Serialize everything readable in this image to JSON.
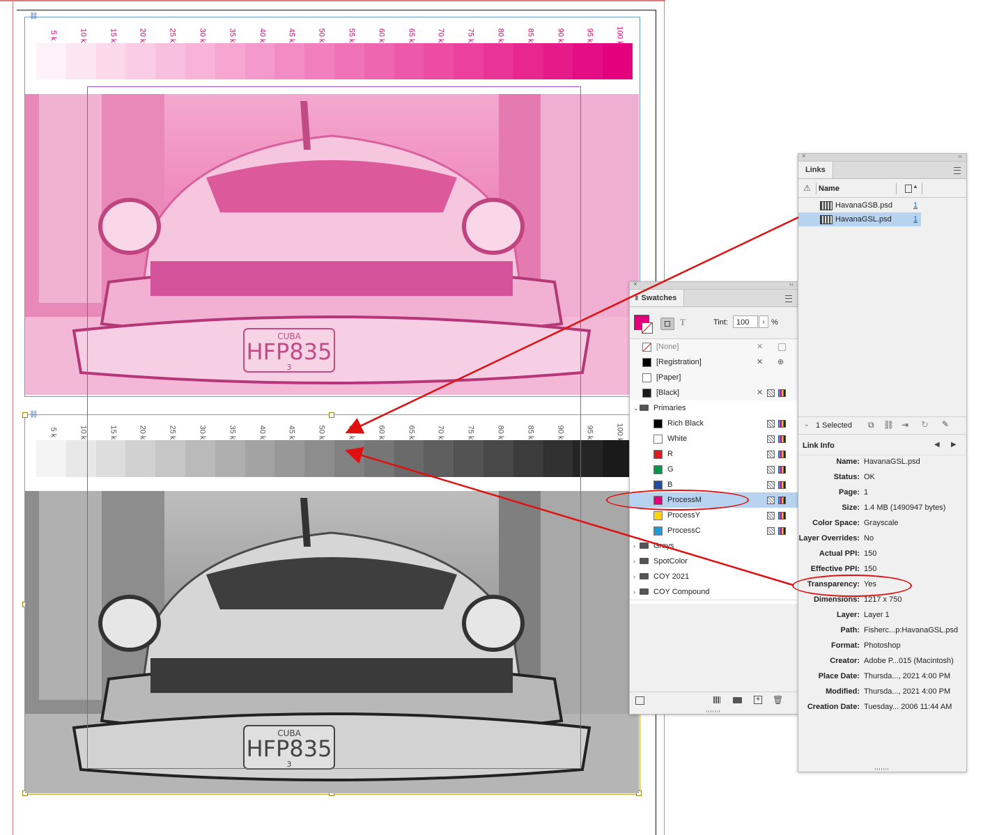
{
  "document": {
    "top_strip_labels": [
      "5 k",
      "10 k",
      "15 k",
      "20 k",
      "25 k",
      "30 k",
      "35 k",
      "40 k",
      "45 k",
      "50 k",
      "55 k",
      "60 k",
      "65 k",
      "70 k",
      "75 k",
      "80 k",
      "85 k",
      "90 k",
      "95 k",
      "100 k"
    ],
    "bottom_strip_labels": [
      "5 k",
      "10 k",
      "15 k",
      "20 k",
      "25 k",
      "30 k",
      "35 k",
      "40 k",
      "45 k",
      "50 k",
      "55 k",
      "60 k",
      "65 k",
      "70 k",
      "75 k",
      "80 k",
      "85 k",
      "90 k",
      "95 k",
      "100 k"
    ],
    "plate_text_cuba": "CUBA",
    "plate_text_number": "HFP835",
    "plate_text_small": "3",
    "colors": {
      "magenta": "#e4007c",
      "black": "#1a1a1a",
      "red_guide": "#e07a7a",
      "frame_blue": "#6a9ec9",
      "frame_gold": "#b89a2a",
      "frame_purple": "#9b4fc9"
    }
  },
  "links_panel": {
    "tab": "Links",
    "col_name": "Name",
    "items": [
      {
        "name": "HavanaGSB.psd",
        "page": "1",
        "selected": false
      },
      {
        "name": "HavanaGSL.psd",
        "page": "1",
        "selected": true
      }
    ],
    "selected_count": "1 Selected",
    "link_info_title": "Link Info",
    "info": [
      {
        "k": "Name:",
        "v": "HavanaGSL.psd"
      },
      {
        "k": "Status:",
        "v": "OK"
      },
      {
        "k": "Page:",
        "v": "1"
      },
      {
        "k": "Size:",
        "v": "1.4 MB (1490947 bytes)"
      },
      {
        "k": "Color Space:",
        "v": "Grayscale"
      },
      {
        "k": "Layer Overrides:",
        "v": "No"
      },
      {
        "k": "Actual PPI:",
        "v": "150"
      },
      {
        "k": "Effective PPI:",
        "v": "150"
      },
      {
        "k": "Transparency:",
        "v": "Yes"
      },
      {
        "k": "Dimensions:",
        "v": "1217 x 750"
      },
      {
        "k": "Layer:",
        "v": "Layer 1"
      },
      {
        "k": "Path:",
        "v": "Fisherc...p:HavanaGSL.psd"
      },
      {
        "k": "Format:",
        "v": "Photoshop"
      },
      {
        "k": "Creator:",
        "v": "Adobe P...015 (Macintosh)"
      },
      {
        "k": "Place Date:",
        "v": "Thursda..., 2021 4:00 PM"
      },
      {
        "k": "Modified:",
        "v": "Thursda..., 2021 4:00 PM"
      },
      {
        "k": "Creation Date:",
        "v": "Tuesday... 2006 11:44 AM"
      }
    ]
  },
  "swatches_panel": {
    "tab": "Swatches",
    "tint_label": "Tint:",
    "tint_value": "100",
    "percent": "%",
    "text_icon": "T",
    "items": [
      {
        "name": "[None]",
        "color": "none",
        "indent": false,
        "folder": false,
        "dim": true
      },
      {
        "name": "[Registration]",
        "color": "#000000",
        "indent": false,
        "folder": false
      },
      {
        "name": "[Paper]",
        "color": "#ffffff",
        "indent": false,
        "folder": false
      },
      {
        "name": "[Black]",
        "color": "#1a1a1a",
        "indent": false,
        "folder": false
      },
      {
        "name": "Primaries",
        "color": "",
        "indent": false,
        "folder": true,
        "open": true
      },
      {
        "name": "Rich Black",
        "color": "#000000",
        "indent": true,
        "folder": false
      },
      {
        "name": "White",
        "color": "#ffffff",
        "indent": true,
        "folder": false
      },
      {
        "name": "R",
        "color": "#e0191f",
        "indent": true,
        "folder": false
      },
      {
        "name": "G",
        "color": "#00984a",
        "indent": true,
        "folder": false
      },
      {
        "name": "B",
        "color": "#1f4e9c",
        "indent": true,
        "folder": false
      },
      {
        "name": "ProcessM",
        "color": "#e4007c",
        "indent": true,
        "folder": false,
        "selected": true
      },
      {
        "name": "ProcessY",
        "color": "#ffd400",
        "indent": true,
        "folder": false
      },
      {
        "name": "ProcessC",
        "color": "#1f9ad7",
        "indent": true,
        "folder": false
      },
      {
        "name": "Grays",
        "color": "",
        "indent": false,
        "folder": true
      },
      {
        "name": "SpotColor",
        "color": "",
        "indent": false,
        "folder": true
      },
      {
        "name": "COY 2021",
        "color": "",
        "indent": false,
        "folder": true
      },
      {
        "name": "COY Compound",
        "color": "",
        "indent": false,
        "folder": true
      }
    ]
  }
}
